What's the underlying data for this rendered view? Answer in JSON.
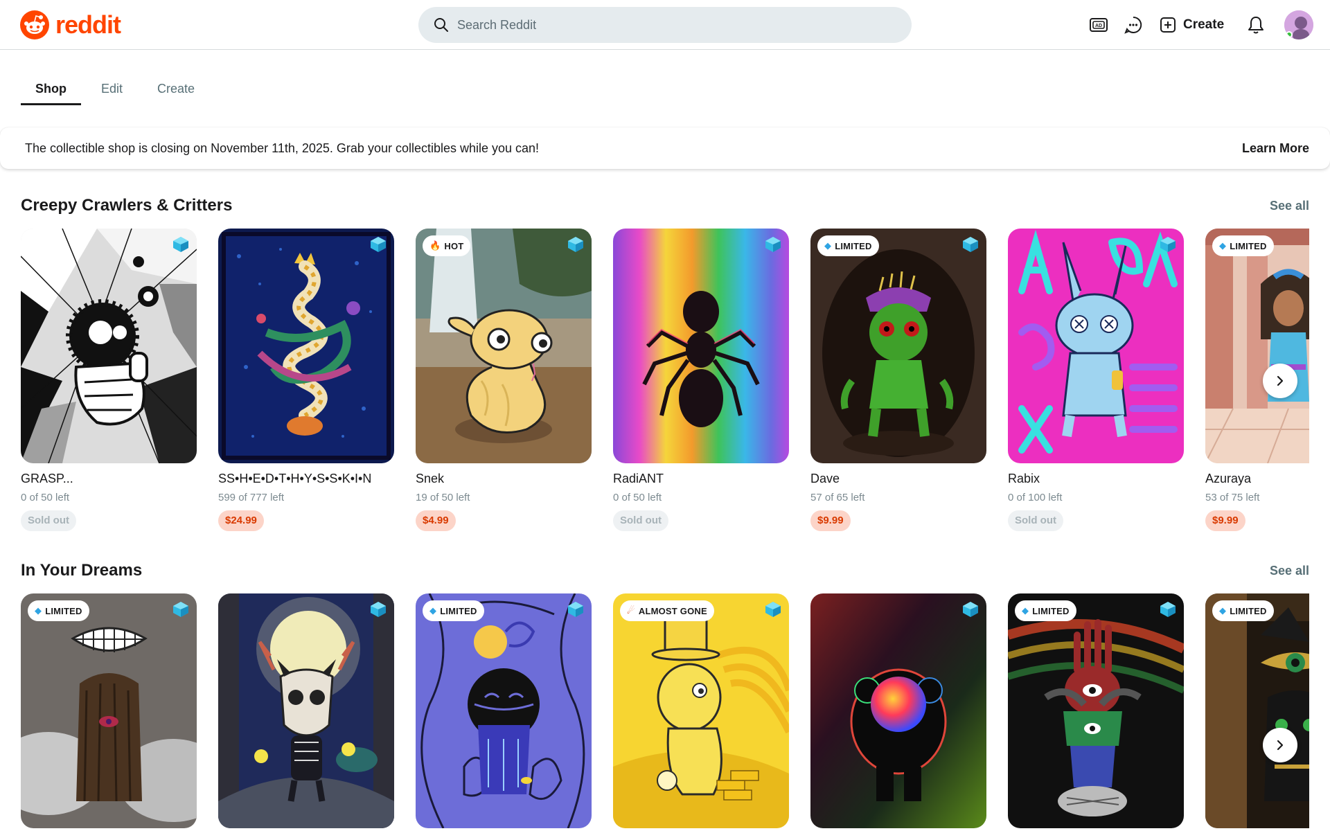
{
  "header": {
    "logo_text": "reddit",
    "search_placeholder": "Search Reddit",
    "create_label": "Create",
    "icons": [
      "advertise-icon",
      "chat-icon",
      "plus-box-icon",
      "bell-icon"
    ]
  },
  "tabs": [
    "Shop",
    "Edit",
    "Create"
  ],
  "active_tab": "Shop",
  "banner": {
    "text": "The collectible shop is closing on November 11th, 2025. Grab your collectibles while you can!",
    "link": "Learn More"
  },
  "sections": [
    {
      "title": "Creepy Crawlers & Critters",
      "see_all": "See all",
      "items": [
        {
          "name": "GRASP...",
          "left": "0 of 50 left",
          "price": "Sold out",
          "sold": true,
          "badge": ""
        },
        {
          "name": "SS•H•E•D•T•H•Y•S•S•K•I•N",
          "left": "599 of 777 left",
          "price": "$24.99",
          "sold": false,
          "badge": ""
        },
        {
          "name": "Snek",
          "left": "19 of 50 left",
          "price": "$4.99",
          "sold": false,
          "badge": "HOT"
        },
        {
          "name": "RadiANT",
          "left": "0 of 50 left",
          "price": "Sold out",
          "sold": true,
          "badge": ""
        },
        {
          "name": "Dave",
          "left": "57 of 65 left",
          "price": "$9.99",
          "sold": false,
          "badge": "LIMITED"
        },
        {
          "name": "Rabix",
          "left": "0 of 100 left",
          "price": "Sold out",
          "sold": true,
          "badge": ""
        },
        {
          "name": "Azuraya",
          "left": "53 of 75 left",
          "price": "$9.99",
          "sold": false,
          "badge": "LIMITED"
        }
      ]
    },
    {
      "title": "In Your Dreams",
      "see_all": "See all",
      "items": [
        {
          "badge": "LIMITED"
        },
        {
          "badge": ""
        },
        {
          "badge": "LIMITED"
        },
        {
          "badge": "ALMOST GONE"
        },
        {
          "badge": ""
        },
        {
          "badge": "LIMITED"
        },
        {
          "badge": "LIMITED"
        }
      ]
    }
  ],
  "colors": {
    "brand": "#ff4500",
    "price_bg": "#fcd4c8",
    "price_text": "#d93a00",
    "sold_bg": "#eef1f3"
  }
}
